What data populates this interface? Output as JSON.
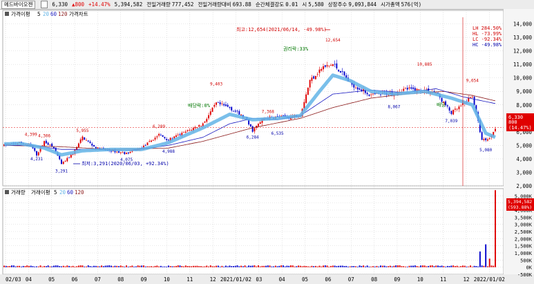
{
  "header": {
    "stock_name": "메드바이오젠",
    "price": "6,330",
    "change": "▲800",
    "change_pct": "+14.47%",
    "volume": "5,394,582",
    "prev_volume_label": "전일거래량",
    "prev_volume": "777,452",
    "prev_volume_ratio_label": "전일거래량대비",
    "prev_volume_ratio": "693.88",
    "strength_label": "순간체결강도",
    "strength": "0.01",
    "open_label": "시",
    "open": "5,580",
    "shares_label": "상장주수",
    "shares": "9,093,844",
    "mcap_label": "시가총액",
    "mcap": "576(억)"
  },
  "price_legend": {
    "series_label": "가격이평",
    "ma5": "5",
    "ma20": "20",
    "ma60": "60",
    "ma120": "120",
    "chart_label": "가격차트"
  },
  "volume_legend": {
    "volume_label": "거래량",
    "series_label": "거래이평",
    "ma5": "5",
    "ma20": "20",
    "ma60": "60",
    "ma120": "120"
  },
  "stats_box": {
    "lh": "LH  284.50%",
    "hl": "HL  -73.99%",
    "lc": "LC  -92.34%",
    "hc": "HC  -49.98%"
  },
  "current_tag": {
    "price": "6,330",
    "change": "800",
    "pct": "(14.47%)"
  },
  "volume_tag": {
    "value": "5,394,582",
    "pct": "(593.88%)"
  },
  "annotations": {
    "max_label": "최고:12,654(2021/06/14, -49.98%)",
    "min_label": "최저:3,291(2020/06/03, +92.34%)",
    "ex_rights": "권리락:33%",
    "ex_div1": "배당락:0%",
    "ex_div2": "배당"
  },
  "price_labels": [
    {
      "t": "4,399",
      "i": 14,
      "p": 5700
    },
    {
      "t": "4,306",
      "i": 21,
      "p": 5600
    },
    {
      "t": "4,231",
      "i": 17,
      "p": 3900
    },
    {
      "t": "3,291",
      "i": 30,
      "p": 3000
    },
    {
      "t": "5,955",
      "i": 41,
      "p": 6000
    },
    {
      "t": "4,075",
      "i": 64,
      "p": 3850
    },
    {
      "t": "6,289",
      "i": 81,
      "p": 6300
    },
    {
      "t": "4,988",
      "i": 86,
      "p": 4450
    },
    {
      "t": "9,403",
      "i": 111,
      "p": 9450
    },
    {
      "t": "6,284",
      "i": 130,
      "p": 5500
    },
    {
      "t": "7,368",
      "i": 138,
      "p": 7400
    },
    {
      "t": "6,535",
      "i": 143,
      "p": 5800
    },
    {
      "t": "12,654",
      "i": 172,
      "p": 12700
    },
    {
      "t": "8,067",
      "i": 204,
      "p": 7750
    },
    {
      "t": "10,885",
      "i": 220,
      "p": 10900
    },
    {
      "t": "7,039",
      "i": 234,
      "p": 6700
    },
    {
      "t": "9,654",
      "i": 245,
      "p": 9700
    },
    {
      "t": "5,080",
      "i": 252,
      "p": 4550
    }
  ],
  "x_labels": [
    "02/03",
    "04",
    "05",
    "06",
    "07",
    "08",
    "09",
    "10",
    "11",
    "12",
    "2021/01/02",
    "03",
    "04",
    "05",
    "06",
    "07",
    "08",
    "09",
    "10",
    "11",
    "12",
    "2022/01/02"
  ],
  "chart_data": {
    "type": "candlestick",
    "price_axis": {
      "ylim": [
        2000,
        15000
      ],
      "ticks": [
        "2,000",
        "3,000",
        "4,000",
        "5,000",
        "6,000",
        "7,000",
        "8,000",
        "9,000",
        "10,000",
        "11,000",
        "12,000",
        "13,000",
        "14,000"
      ]
    },
    "volume_axis": {
      "ylim": [
        -500000,
        5500000
      ],
      "ticks": [
        "-500K",
        "0K",
        "500K",
        "1,000K",
        "1,500K",
        "2,000K",
        "2,500K",
        "3,000K",
        "3,500K",
        "4,000K",
        "4,500K",
        "5,000K"
      ]
    },
    "price_anchors": [
      [
        0,
        5000
      ],
      [
        8,
        5200
      ],
      [
        14,
        5000
      ],
      [
        17,
        4300
      ],
      [
        21,
        5300
      ],
      [
        26,
        4800
      ],
      [
        30,
        3600
      ],
      [
        36,
        4400
      ],
      [
        41,
        5600
      ],
      [
        48,
        4800
      ],
      [
        56,
        4600
      ],
      [
        64,
        4400
      ],
      [
        72,
        4800
      ],
      [
        81,
        5800
      ],
      [
        86,
        5400
      ],
      [
        95,
        6000
      ],
      [
        104,
        6600
      ],
      [
        111,
        8100
      ],
      [
        118,
        7800
      ],
      [
        126,
        7000
      ],
      [
        130,
        6100
      ],
      [
        136,
        7000
      ],
      [
        143,
        7100
      ],
      [
        150,
        7100
      ],
      [
        155,
        7300
      ],
      [
        160,
        9800
      ],
      [
        166,
        10700
      ],
      [
        172,
        11000
      ],
      [
        176,
        10500
      ],
      [
        181,
        9600
      ],
      [
        186,
        9200
      ],
      [
        192,
        8700
      ],
      [
        198,
        8800
      ],
      [
        204,
        8900
      ],
      [
        210,
        9200
      ],
      [
        215,
        9100
      ],
      [
        220,
        9100
      ],
      [
        226,
        8900
      ],
      [
        234,
        7400
      ],
      [
        240,
        8000
      ],
      [
        245,
        8700
      ],
      [
        250,
        5400
      ],
      [
        254,
        5500
      ],
      [
        257,
        6330
      ]
    ],
    "ma20_anchors": [
      [
        0,
        5100
      ],
      [
        8,
        5150
      ],
      [
        14,
        5000
      ],
      [
        21,
        4800
      ],
      [
        30,
        4300
      ],
      [
        41,
        4600
      ],
      [
        56,
        4700
      ],
      [
        72,
        4700
      ],
      [
        86,
        5200
      ],
      [
        104,
        6300
      ],
      [
        118,
        7300
      ],
      [
        130,
        6900
      ],
      [
        143,
        7000
      ],
      [
        155,
        7200
      ],
      [
        165,
        9000
      ],
      [
        172,
        10200
      ],
      [
        181,
        9800
      ],
      [
        192,
        9000
      ],
      [
        204,
        8800
      ],
      [
        220,
        9000
      ],
      [
        234,
        8500
      ],
      [
        245,
        8000
      ],
      [
        252,
        5900
      ],
      [
        257,
        5600
      ]
    ],
    "ma60_anchors": [
      [
        0,
        5000
      ],
      [
        14,
        5000
      ],
      [
        30,
        4700
      ],
      [
        48,
        4700
      ],
      [
        64,
        4600
      ],
      [
        86,
        5000
      ],
      [
        104,
        5600
      ],
      [
        118,
        6600
      ],
      [
        130,
        7000
      ],
      [
        143,
        6900
      ],
      [
        155,
        7200
      ],
      [
        172,
        8800
      ],
      [
        192,
        9100
      ],
      [
        210,
        8900
      ],
      [
        226,
        9200
      ],
      [
        240,
        8600
      ],
      [
        250,
        8300
      ],
      [
        257,
        8100
      ]
    ],
    "ma120_anchors": [
      [
        0,
        5000
      ],
      [
        30,
        4900
      ],
      [
        56,
        4700
      ],
      [
        86,
        4800
      ],
      [
        104,
        5300
      ],
      [
        130,
        6300
      ],
      [
        155,
        7000
      ],
      [
        172,
        7800
      ],
      [
        192,
        8500
      ],
      [
        210,
        8800
      ],
      [
        230,
        9000
      ],
      [
        245,
        8700
      ],
      [
        257,
        8300
      ]
    ],
    "volume_spikes": [
      [
        249,
        1100000
      ],
      [
        252,
        1600000
      ],
      [
        254,
        600000
      ],
      [
        257,
        5394582
      ]
    ],
    "n_bars": 258
  },
  "colors": {
    "up": "#e00000",
    "down": "#0000cc",
    "ma5": "#000000",
    "ma20": "#63b4e6",
    "ma60": "#1818c0",
    "ma120": "#8b1a1a",
    "grid": "#d0d0d0",
    "gridline_v": "#b8b8b8"
  }
}
